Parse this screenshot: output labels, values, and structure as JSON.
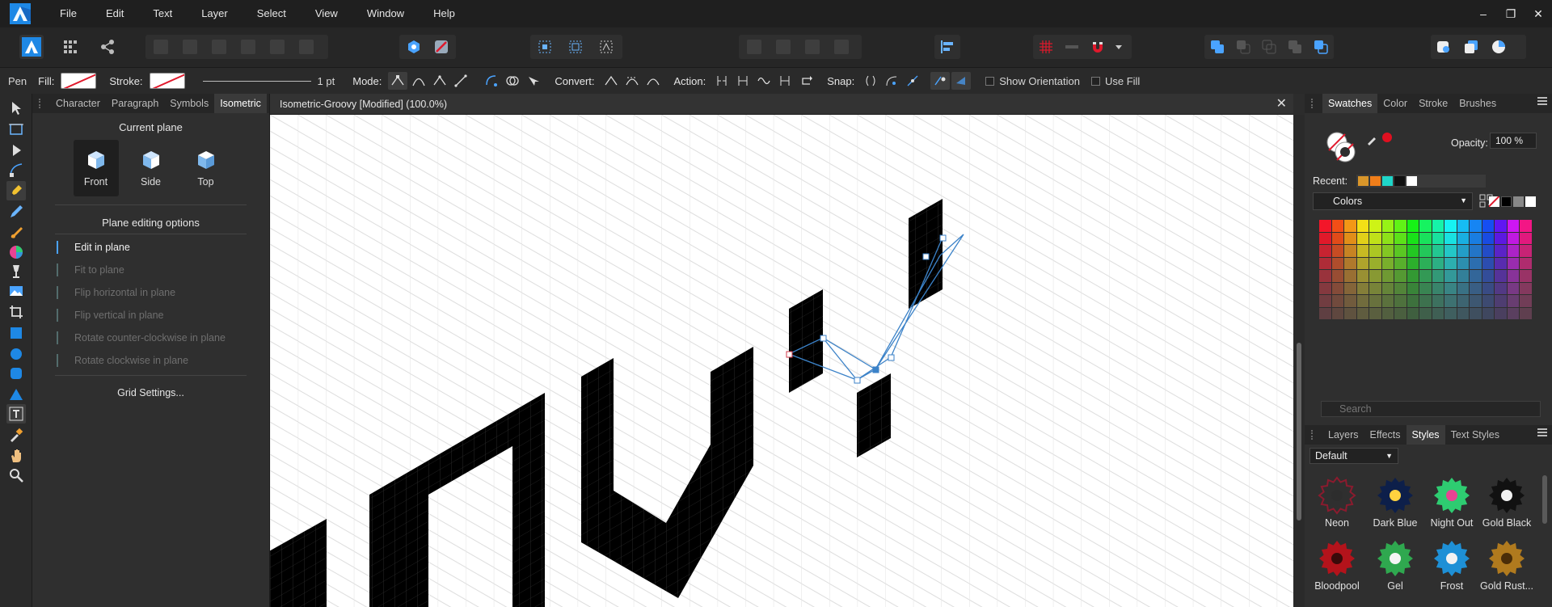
{
  "app": {
    "name": "Affinity Designer",
    "brand_color": "#1e88e5"
  },
  "menu": [
    "File",
    "Edit",
    "Text",
    "Layer",
    "Select",
    "View",
    "Window",
    "Help"
  ],
  "window_controls": {
    "minimize": "–",
    "restore": "❐",
    "close": "✕"
  },
  "context": {
    "tool_name": "Pen",
    "fill_label": "Fill:",
    "stroke_label": "Stroke:",
    "stroke_width": "1 pt",
    "mode_label": "Mode:",
    "convert_label": "Convert:",
    "action_label": "Action:",
    "snap_label": "Snap:",
    "show_orientation": "Show Orientation",
    "use_fill": "Use Fill"
  },
  "left_panel": {
    "tabs": [
      "Character",
      "Paragraph",
      "Symbols",
      "Isometric"
    ],
    "active_tab": "Isometric",
    "current_plane_title": "Current plane",
    "planes": [
      "Front",
      "Side",
      "Top"
    ],
    "active_plane": "Front",
    "plane_options_title": "Plane editing options",
    "options": [
      {
        "label": "Edit in plane",
        "enabled": true
      },
      {
        "label": "Fit to plane",
        "enabled": false
      },
      {
        "label": "Flip horizontal in plane",
        "enabled": false
      },
      {
        "label": "Flip vertical in plane",
        "enabled": false
      },
      {
        "label": "Rotate counter-clockwise in plane",
        "enabled": false
      },
      {
        "label": "Rotate clockwise in plane",
        "enabled": false
      }
    ],
    "grid_settings": "Grid Settings..."
  },
  "document": {
    "title": "Isometric-Groovy [Modified] (100.0%)",
    "close_label": "✕"
  },
  "right_panel": {
    "tabs": [
      "Swatches",
      "Color",
      "Stroke",
      "Brushes"
    ],
    "active_tab": "Swatches",
    "opacity_label": "Opacity:",
    "opacity_value": "100 %",
    "recent_label": "Recent:",
    "recent_colors": [
      "#d9962a",
      "#f07e1a",
      "#1fd6c9",
      "#111111",
      "#ffffff"
    ],
    "palette": "Colors",
    "search_placeholder": "Search",
    "studio_tabs": [
      "Layers",
      "Effects",
      "Styles",
      "Text Styles"
    ],
    "active_studio_tab": "Styles",
    "style_category": "Default",
    "styles": [
      {
        "name": "Neon",
        "color": "#8b1b2e",
        "inner": "#2d2d2d"
      },
      {
        "name": "Dark Blue",
        "color": "#0d1f4a",
        "inner": "#ffd23f"
      },
      {
        "name": "Night Out",
        "color": "#2ecc71",
        "inner": "#e84393"
      },
      {
        "name": "Gold Black",
        "color": "#111111",
        "inner": "#f0f0f0"
      },
      {
        "name": "Bloodpool",
        "color": "#b3131b",
        "inner": "#3a0a0a"
      },
      {
        "name": "Gel",
        "color": "#2fa84f",
        "inner": "#f5f5f5"
      },
      {
        "name": "Frost",
        "color": "#1e90d6",
        "inner": "#f2f2f2"
      },
      {
        "name": "Gold Rust...",
        "color": "#b07a1e",
        "inner": "#4a2d08"
      }
    ]
  }
}
